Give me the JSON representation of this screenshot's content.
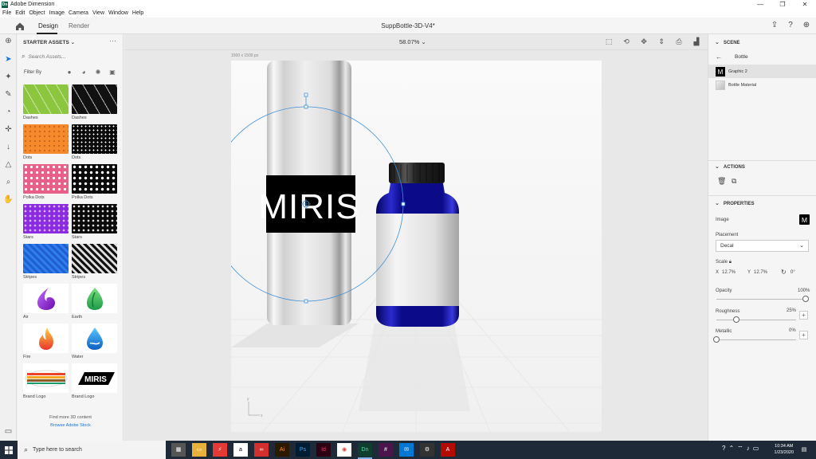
{
  "window": {
    "title": "Adobe Dimension",
    "controls": [
      "—",
      "❐",
      "✕"
    ]
  },
  "menu": [
    "File",
    "Edit",
    "Object",
    "Image",
    "Camera",
    "View",
    "Window",
    "Help"
  ],
  "tabs": {
    "design": "Design",
    "render": "Render"
  },
  "document_title": "SuppBottle-3D-V4*",
  "assets": {
    "header": "STARTER ASSETS ⌄",
    "more": "···",
    "search_placeholder": "Search Assets...",
    "filter_label": "Filter By",
    "items": [
      {
        "label": "Dashes"
      },
      {
        "label": "Dashes"
      },
      {
        "label": "Dots"
      },
      {
        "label": "Dots"
      },
      {
        "label": "Polka Dots"
      },
      {
        "label": "Polka Dots"
      },
      {
        "label": "Stars"
      },
      {
        "label": "Stars"
      },
      {
        "label": "Stripes"
      },
      {
        "label": "Stripes"
      },
      {
        "label": "Air"
      },
      {
        "label": "Earth"
      },
      {
        "label": "Fire"
      },
      {
        "label": "Water"
      },
      {
        "label": "Brand Logo"
      },
      {
        "label": "Brand Logo"
      }
    ],
    "find_more": "Find more 3D content",
    "browse_link": "Browse Adobe Stock"
  },
  "canvas": {
    "zoom": "58.07%",
    "size_label": "1500 x 1500 px",
    "logo_text": "MIRIS",
    "axis_y": "y",
    "axis_x": "x"
  },
  "scene": {
    "header": "SCENE",
    "back_label": "Bottle",
    "layers": [
      "Graphic 2",
      "Bottle Material"
    ]
  },
  "actions": {
    "header": "ACTIONS"
  },
  "properties": {
    "header": "PROPERTIES",
    "image_label": "Image",
    "placement_label": "Placement",
    "placement_value": "Decal",
    "scale_label": "Scale",
    "scale_x_label": "X",
    "scale_x": "12.7%",
    "scale_y_label": "Y",
    "scale_y": "12.7%",
    "rotation": "0°",
    "opacity_label": "Opacity",
    "opacity_value": "100%",
    "opacity": 1.0,
    "roughness_label": "Roughness",
    "roughness_value": "25%",
    "roughness": 0.25,
    "metallic_label": "Metallic",
    "metallic_value": "0%",
    "metallic": 0.0
  },
  "taskbar": {
    "search_placeholder": "Type here to search",
    "time": "10:34 AM",
    "date": "1/23/2020",
    "apps": [
      "calculator",
      "file-explorer",
      "amazon",
      "creative-cloud",
      "illustrator",
      "photoshop",
      "indesign",
      "chrome",
      "dimension",
      "slack",
      "mail",
      "settings",
      "acrobat"
    ]
  },
  "colors": {
    "accent": "#1473e6",
    "bottle_blue": "#0b0b8a",
    "taskbar": "#1f2a38"
  }
}
